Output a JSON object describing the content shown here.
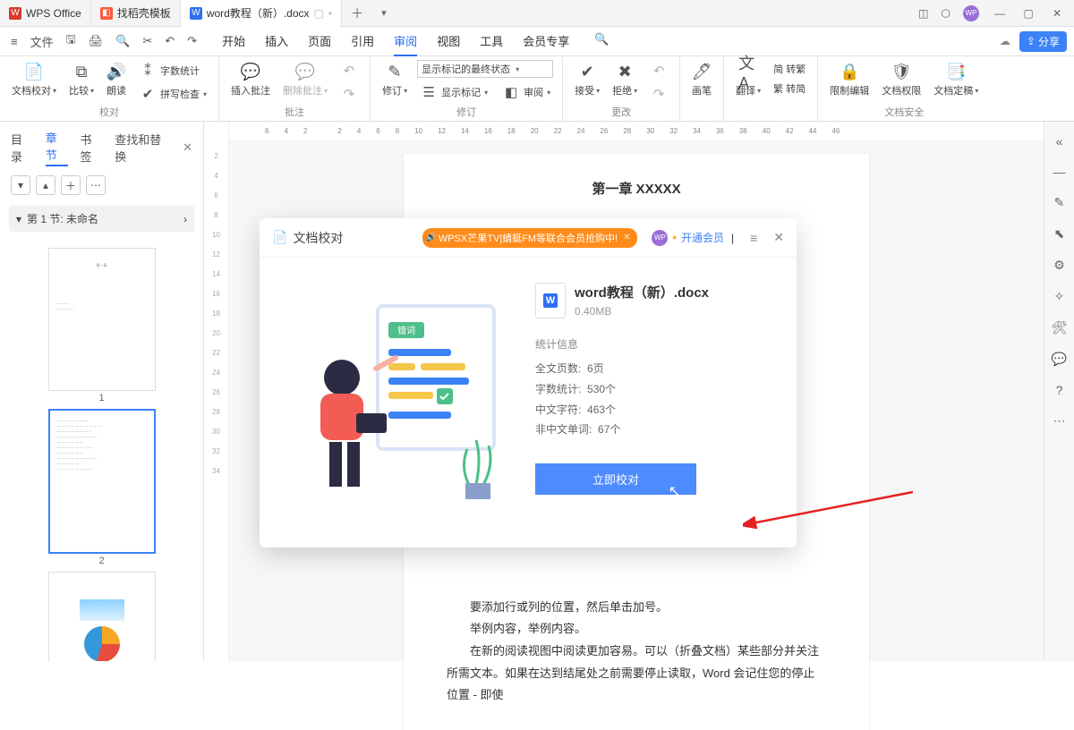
{
  "titlebar": {
    "tabs": [
      {
        "label": "WPS Office",
        "icon_bg": "#d63b2b",
        "icon_text": "W"
      },
      {
        "label": "找稻壳模板",
        "icon_bg": "#ff5a3c",
        "icon_text": "◧"
      },
      {
        "label": "word教程（新）.docx",
        "icon_bg": "#2e6ff2",
        "icon_text": "W",
        "active": true
      }
    ],
    "avatar": "WP"
  },
  "menubar": {
    "file": "文件",
    "tabs": [
      "开始",
      "插入",
      "页面",
      "引用",
      "审阅",
      "视图",
      "工具",
      "会员专享"
    ],
    "active": "审阅",
    "share": "分享"
  },
  "ribbon": {
    "g1": {
      "name": "校对",
      "btns": {
        "proof": "文档校对",
        "compare": "比较",
        "read": "朗读",
        "wc": "字数统计",
        "spell": "拼写检查"
      }
    },
    "g2": {
      "name": "批注",
      "btns": {
        "ins": "插入批注",
        "del": "删除批注"
      }
    },
    "g3": {
      "name": "修订",
      "btns": {
        "rev": "修订",
        "show": "显示标记",
        "review": "审阅"
      },
      "combo": "显示标记的最终状态"
    },
    "g4": {
      "name": "更改",
      "btns": {
        "accept": "接受",
        "reject": "拒绝"
      }
    },
    "g5": {
      "btns": {
        "pen": "画笔"
      }
    },
    "g6": {
      "btns": {
        "translate": "翻译",
        "t2s_a": "简  转繁",
        "t2s_b": "繁  转简"
      }
    },
    "g7": {
      "name": "文档安全",
      "btns": {
        "restrict": "限制编辑",
        "perm": "文档权限",
        "lock": "文档定稿"
      }
    }
  },
  "nav": {
    "tabs": [
      "目录",
      "章节",
      "书签",
      "查找和替换"
    ],
    "active": "章节",
    "section": "第 1 节: 未命名",
    "pages": [
      "1",
      "2"
    ]
  },
  "ruler_h": [
    "6",
    "4",
    "2",
    "",
    "2",
    "4",
    "6",
    "8",
    "10",
    "12",
    "14",
    "16",
    "18",
    "20",
    "22",
    "24",
    "26",
    "28",
    "30",
    "32",
    "34",
    "36",
    "38",
    "40",
    "42",
    "44",
    "46"
  ],
  "ruler_v": [
    "2",
    "4",
    "6",
    "8",
    "10",
    "12",
    "14",
    "16",
    "18",
    "20",
    "22",
    "24",
    "26",
    "28",
    "30",
    "32",
    "34"
  ],
  "doc": {
    "heading": "第一章  XXXXX",
    "p1": "要添加行或列的位置，然后单击加号。",
    "p2": "举例内容，举例内容。",
    "p3": "在新的阅读视图中阅读更加容易。可以（折叠文档）某些部分并关注所需文本。如果在达到结尾处之前需要停止读取，Word 会记住您的停止位置 - 即使"
  },
  "dialog": {
    "title": "文档校对",
    "promo": "WPSX芒果TV|蜻蜓FM等联合会员抢购中!",
    "vip": "开通会员",
    "illus_badge": "错词",
    "file": {
      "name": "word教程（新）.docx",
      "size": "0.40MB"
    },
    "stats_title": "统计信息",
    "stats": {
      "pages_l": "全文页数:",
      "pages_v": "6页",
      "words_l": "字数统计:",
      "words_v": "530个",
      "cjk_l": "中文字符:",
      "cjk_v": "463个",
      "noncjk_l": "非中文单词:",
      "noncjk_v": "67个"
    },
    "cta": "立即校对"
  }
}
